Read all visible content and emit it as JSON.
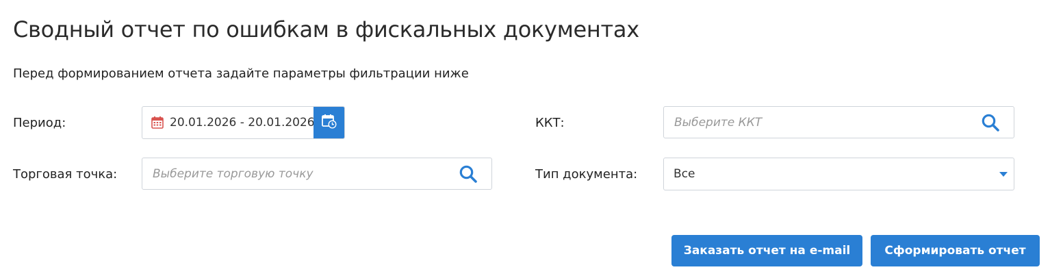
{
  "page": {
    "title": "Сводный отчет по ошибкам в фискальных документах",
    "subtitle": "Перед формированием отчета задайте параметры фильтрации ниже"
  },
  "filters": {
    "period": {
      "label": "Период:",
      "value": "20.01.2026 - 20.01.2026",
      "icon": "calendar-icon",
      "button_icon": "calendar-clock-icon"
    },
    "kkt": {
      "label": "ККТ:",
      "placeholder": "Выберите ККТ",
      "icon": "search-icon"
    },
    "store": {
      "label": "Торговая точка:",
      "placeholder": "Выберите торговую точку",
      "icon": "search-icon"
    },
    "doc_type": {
      "label": "Тип документа:",
      "selected": "Все",
      "icon": "chevron-down-icon"
    }
  },
  "actions": {
    "email_label": "Заказать отчет на e-mail",
    "generate_label": "Сформировать отчет"
  },
  "colors": {
    "accent": "#2a7fd4",
    "calendar_icon": "#d9534f",
    "border": "#cfd4da",
    "placeholder": "#999999"
  }
}
